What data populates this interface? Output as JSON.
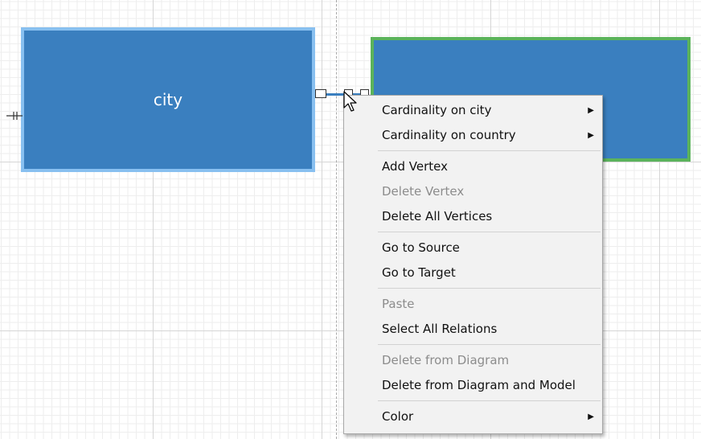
{
  "diagram": {
    "entities": [
      {
        "id": "city",
        "label": "city"
      },
      {
        "id": "country",
        "label": ""
      }
    ]
  },
  "context_menu": {
    "groups": [
      [
        {
          "label": "Cardinality on city",
          "enabled": true,
          "submenu": true
        },
        {
          "label": "Cardinality on country",
          "enabled": true,
          "submenu": true
        }
      ],
      [
        {
          "label": "Add Vertex",
          "enabled": true
        },
        {
          "label": "Delete Vertex",
          "enabled": false
        },
        {
          "label": "Delete All Vertices",
          "enabled": true
        }
      ],
      [
        {
          "label": "Go to Source",
          "enabled": true
        },
        {
          "label": "Go to Target",
          "enabled": true
        }
      ],
      [
        {
          "label": "Paste",
          "enabled": false
        },
        {
          "label": "Select All Relations",
          "enabled": true
        }
      ],
      [
        {
          "label": "Delete from Diagram",
          "enabled": false
        },
        {
          "label": "Delete from Diagram and Model",
          "enabled": true
        }
      ],
      [
        {
          "label": "Color",
          "enabled": true,
          "submenu": true
        }
      ]
    ]
  },
  "colors": {
    "entity_fill": "#3a7fbf",
    "city_border_selected": "#88c0f0",
    "country_border": "#5bb35b",
    "menu_background": "#f2f2f2",
    "disabled_text": "#8c8c8c"
  }
}
